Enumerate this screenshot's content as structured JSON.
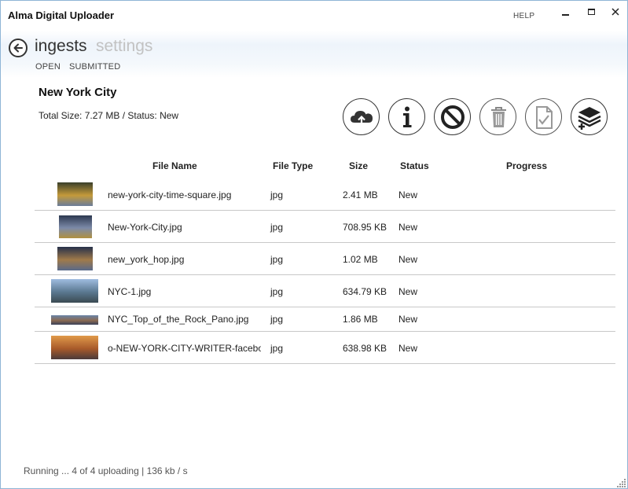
{
  "app": {
    "title": "Alma Digital Uploader",
    "help": "HELP"
  },
  "nav": {
    "tab_ingests": "ingests",
    "tab_settings": "settings",
    "sub_open": "OPEN",
    "sub_submitted": "SUBMITTED"
  },
  "set": {
    "title": "New York City",
    "summary": "Total Size: 7.27 MB / Status: New"
  },
  "actions": [
    "upload-icon",
    "info-icon",
    "cancel-icon",
    "trash-icon",
    "document-check-icon",
    "layers-add-icon"
  ],
  "columns": {
    "file_name": "File Name",
    "file_type": "File Type",
    "size": "Size",
    "status": "Status",
    "progress": "Progress"
  },
  "files": [
    {
      "name": "new-york-city-time-square.jpg",
      "type": "jpg",
      "size": "2.41 MB",
      "status": "New",
      "thumb_colors": [
        "#3a3f2a",
        "#c49a3a",
        "#6b7d9a"
      ]
    },
    {
      "name": "New-York-City.jpg",
      "type": "jpg",
      "size": "708.95 KB",
      "status": "New",
      "thumb_colors": [
        "#2c3850",
        "#7c8aa8",
        "#b09040"
      ]
    },
    {
      "name": "new_york_hop.jpg",
      "type": "jpg",
      "size": "1.02 MB",
      "status": "New",
      "thumb_colors": [
        "#26304a",
        "#a07a4a",
        "#5a6a8a"
      ]
    },
    {
      "name": "NYC-1.jpg",
      "type": "jpg",
      "size": "634.79 KB",
      "status": "New",
      "thumb_colors": [
        "#9fbce0",
        "#5a7890",
        "#3a4a52"
      ]
    },
    {
      "name": "NYC_Top_of_the_Rock_Pano.jpg",
      "type": "jpg",
      "size": "1.86 MB",
      "status": "New",
      "thumb_colors": [
        "#6a84a8",
        "#8a6a52",
        "#3a4058"
      ]
    },
    {
      "name": "o-NEW-YORK-CITY-WRITER-facebook.jpg",
      "type": "jpg",
      "size": "638.98 KB",
      "status": "New",
      "thumb_colors": [
        "#e09a4a",
        "#a85a2a",
        "#4a3a3a"
      ]
    }
  ],
  "status_bar": "Running ... 4 of 4 uploading | 136 kb / s",
  "colors": {
    "window_border": "#8fb5d6",
    "header_tint": "#eef4fb",
    "inactive_tab": "#c2c2c2"
  }
}
